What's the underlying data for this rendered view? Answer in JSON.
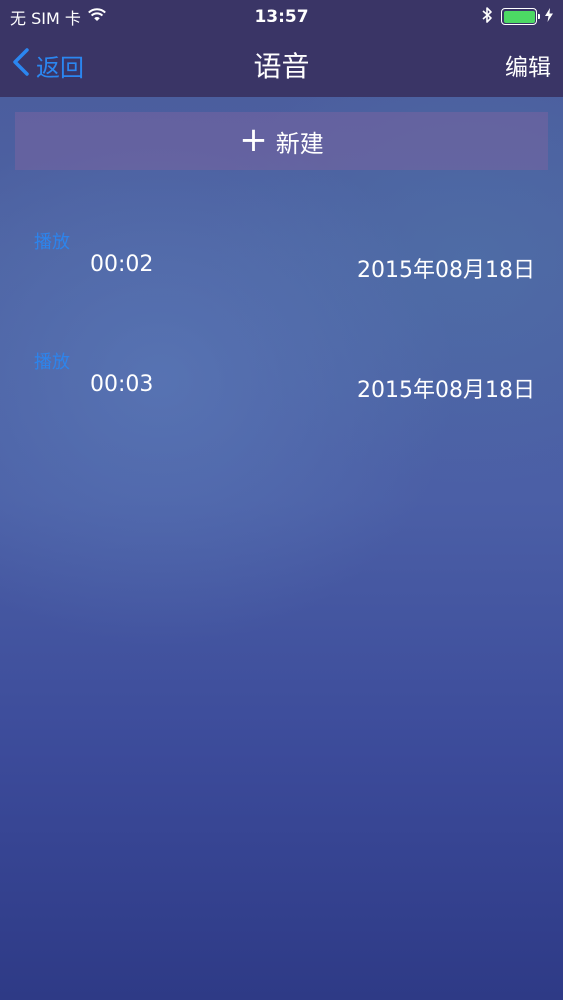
{
  "status_bar": {
    "carrier": "无 SIM 卡",
    "time": "13:57",
    "icons": [
      "wifi-icon",
      "bluetooth-icon",
      "battery-icon",
      "charging-icon"
    ]
  },
  "nav": {
    "back_label": "返回",
    "title": "语音",
    "edit_label": "编辑"
  },
  "new_button": {
    "label": "新建"
  },
  "recordings": [
    {
      "play_label": "播放",
      "duration": "00:02",
      "date": "2015年08月18日"
    },
    {
      "play_label": "播放",
      "duration": "00:03",
      "date": "2015年08月18日"
    }
  ],
  "colors": {
    "accent": "#2b86f0",
    "bar": "#3a3566",
    "battery": "#4cd964"
  }
}
